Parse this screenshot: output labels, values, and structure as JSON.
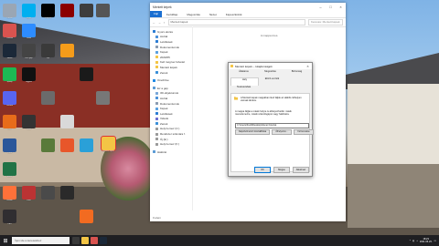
{
  "explorer": {
    "title": "Mentett képek",
    "ribbon_tabs": [
      "Fájl",
      "Kezdőlap",
      "Megosztás",
      "Nézet",
      "Képeszközök"
    ],
    "address": "Mentett képek",
    "search_placeholder": "Keresés: Mentett képek",
    "empty_message": "A mappa üres.",
    "status_text": "0 elem",
    "nav": {
      "quick_access": "Gyors elérés",
      "pinned": [
        "Asztal",
        "Letöltések",
        "Dokumentumok",
        "Képek",
        "2020/05",
        "Kell még ker felvétel",
        "Mentett képek",
        "Zenék"
      ],
      "onedrive": "OneDrive",
      "this_pc": "Ez a gép",
      "pc_items": [
        "3D-objektumok",
        "Asztal",
        "Dokumentumok",
        "Képek",
        "Letöltések",
        "Videók",
        "Zenék",
        "Helyi lemez (C:)",
        "Rendszer számára f.",
        "Új (E:)",
        "Helyi lemez (F:)"
      ],
      "network": "Hálózat"
    }
  },
  "dialog": {
    "title": "Mentett képek – tulajdonságok",
    "tabs": [
      "Általános",
      "Megosztás",
      "Biztonság",
      "Hely",
      "Előző verziók",
      "Testreszabás"
    ],
    "active_tab": "Hely",
    "info_text": "A Mentett képek mappában lévő fájlok az alábbi célhelyen vannak tárolva.",
    "description": "A mappa fájljai a másik helyre is áthelyezhetők: másik merevlemezre, másik számítógépre vagy hálózatra.",
    "path": "C:\\Users\\Zsolt\\Desktop\\Zenei Fotozat",
    "buttons": [
      "Alapértelmezett visszaállítása",
      "Áthelyezés...",
      "Cél keresése"
    ],
    "ok_label": "OK",
    "cancel_label": "Mégse",
    "apply_label": "Alkalmaz"
  },
  "taskbar": {
    "search_placeholder": "Írjon ide a kereséshez",
    "clock_time": "18:23",
    "clock_date": "2021.06.23."
  },
  "desktop": {
    "selected_icon_label": "Mentett képek",
    "labels": [
      "Lomtár",
      "Chrome",
      "Steam",
      "Spotify",
      "Discord",
      "VLC",
      "Word",
      "Excel",
      "Firefox",
      "OBS",
      "Skype",
      "Zoom",
      "Ez a gép",
      "Jegyzet",
      "Fotók",
      "Zene",
      "Mentett képek",
      "Játék",
      "Telegram",
      "Zip"
    ]
  }
}
